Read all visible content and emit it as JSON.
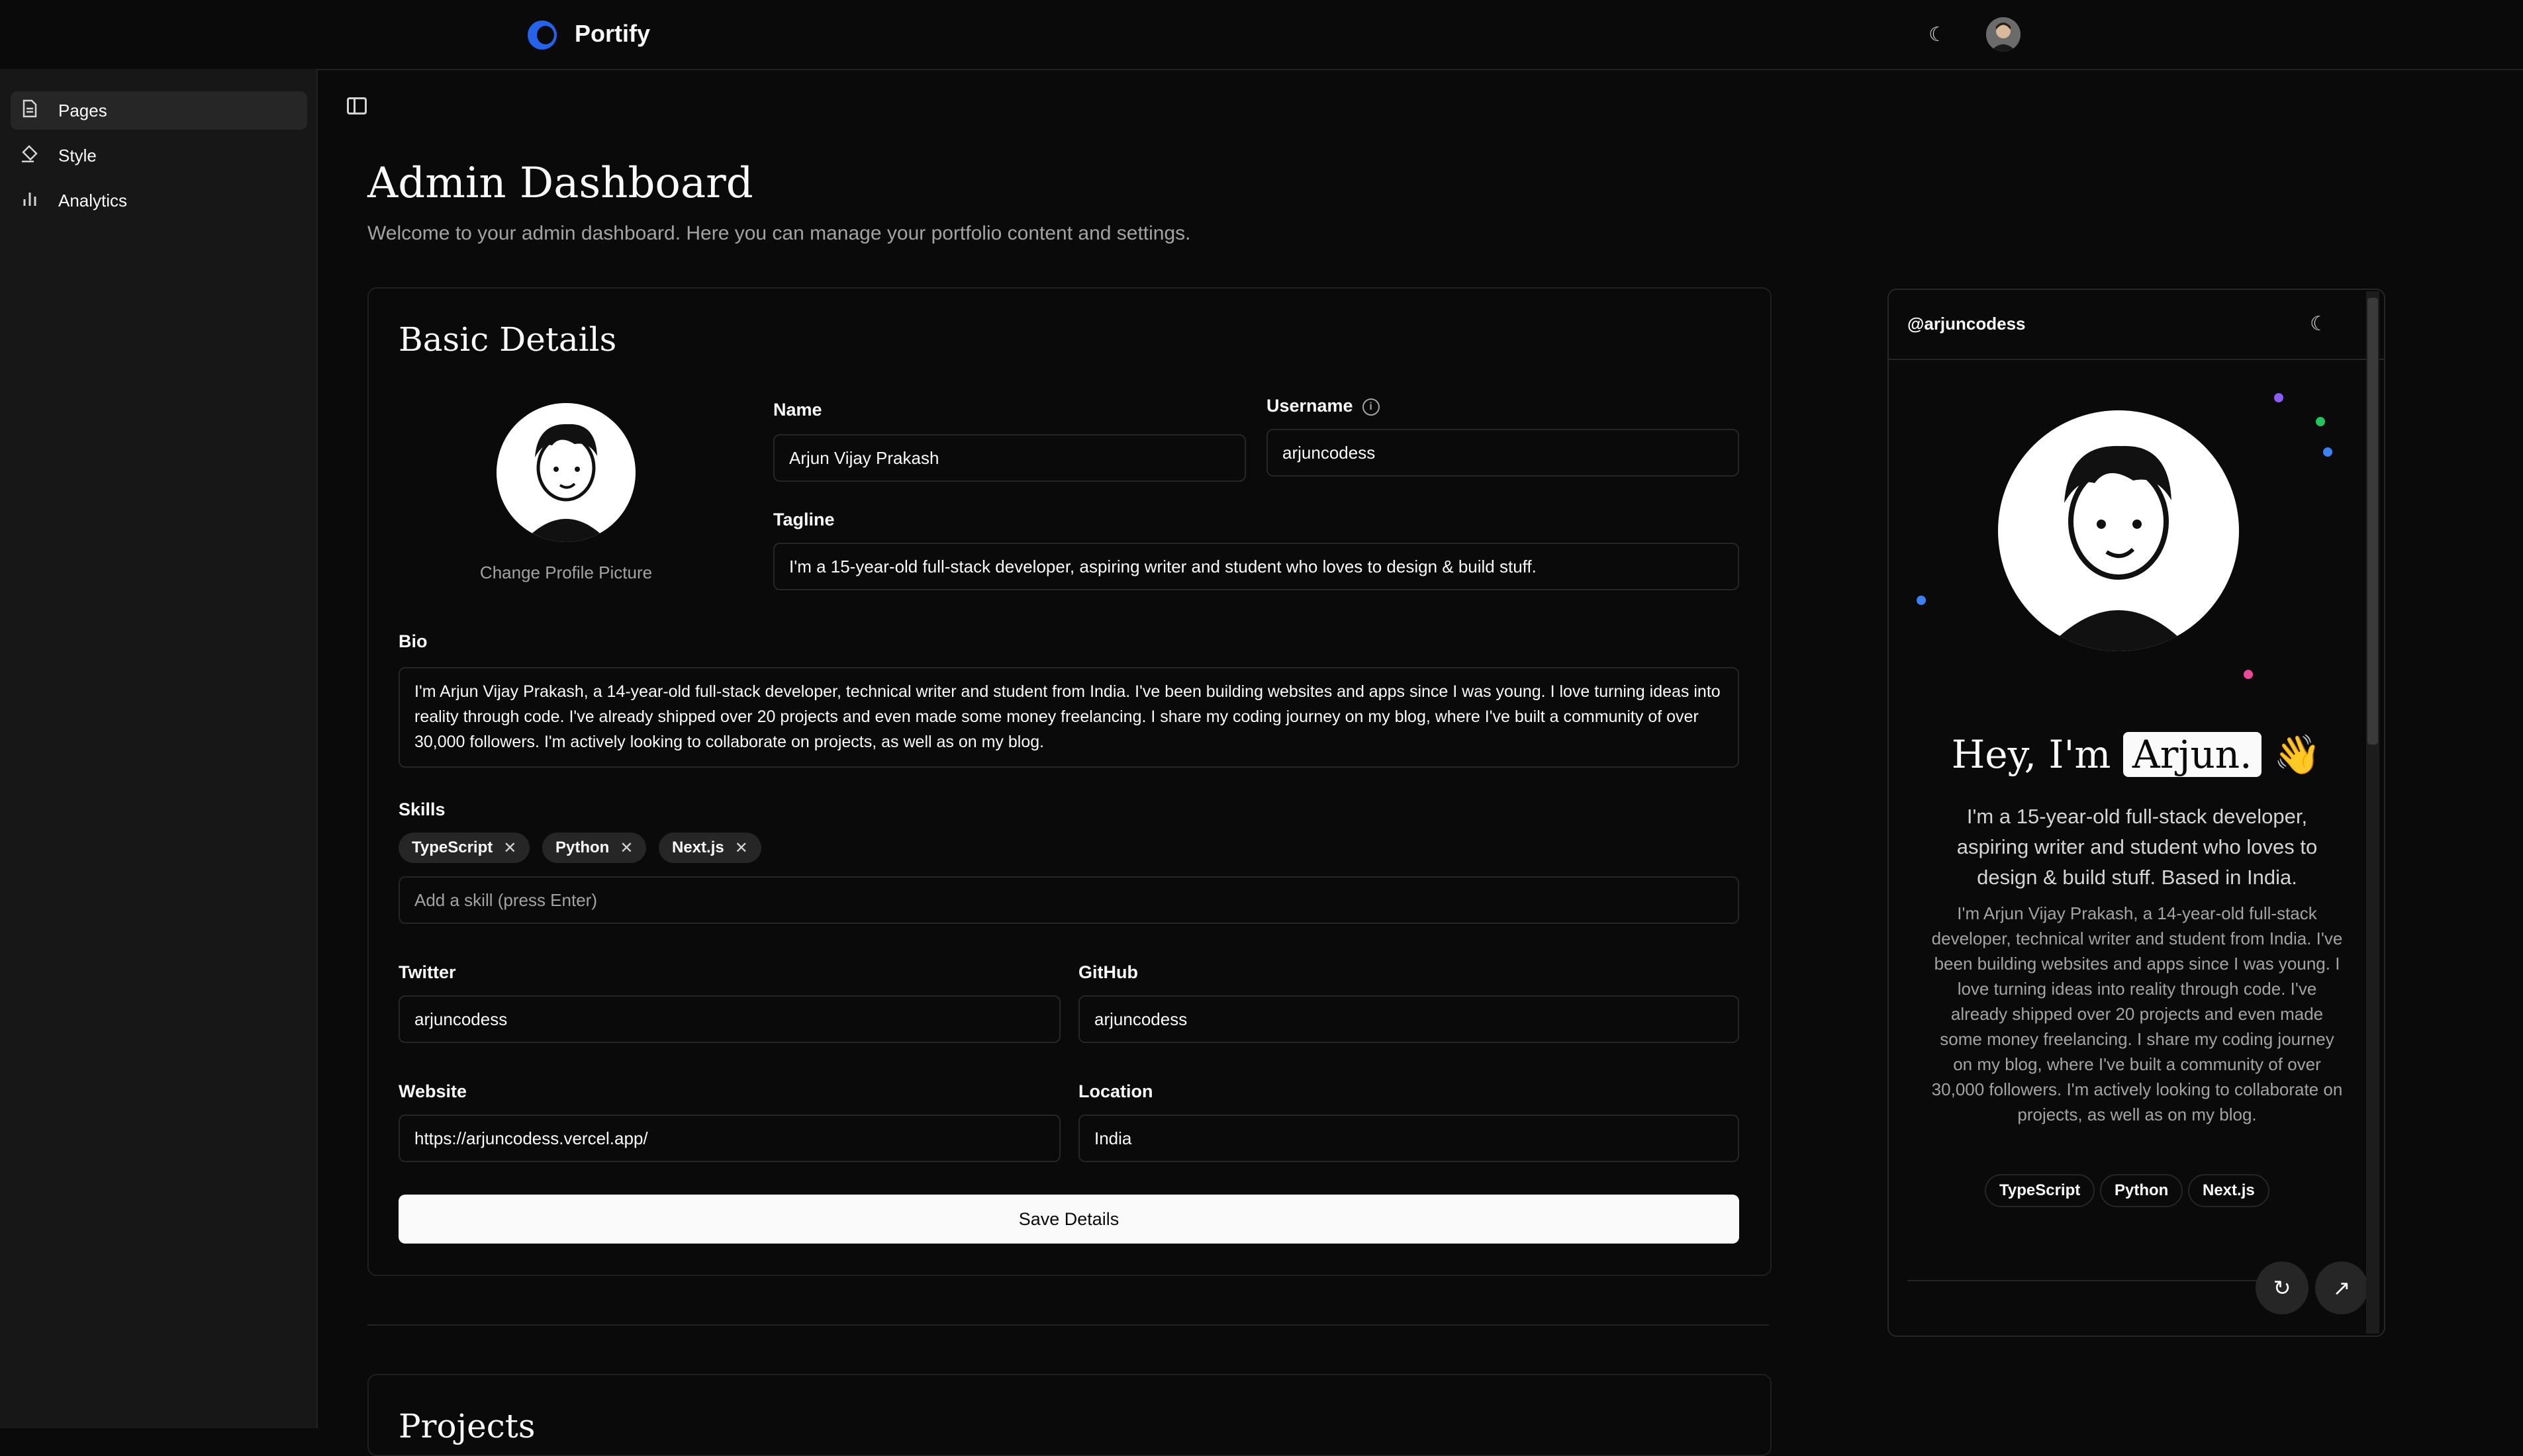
{
  "app": {
    "name": "Portify"
  },
  "sidebar": {
    "items": [
      {
        "label": "Pages",
        "icon": "file-icon",
        "active": true
      },
      {
        "label": "Style",
        "icon": "paint-bucket-icon",
        "active": false
      },
      {
        "label": "Analytics",
        "icon": "bar-chart-icon",
        "active": false
      }
    ]
  },
  "main": {
    "title": "Admin Dashboard",
    "subtitle": "Welcome to your admin dashboard. Here you can manage your portfolio content and settings."
  },
  "basic": {
    "title": "Basic Details",
    "change_picture": "Change Profile Picture",
    "name_label": "Name",
    "name_value": "Arjun Vijay Prakash",
    "username_label": "Username",
    "username_value": "arjuncodess",
    "tagline_label": "Tagline",
    "tagline_value": "I'm a 15-year-old full-stack developer, aspiring writer and student who loves to design & build stuff.",
    "bio_label": "Bio",
    "bio_value": "I'm Arjun Vijay Prakash, a 14-year-old full-stack developer, technical writer and student from India. I've been building websites and apps since I was young. I love turning ideas into reality through code. I've already shipped over 20 projects and even made some money freelancing. I share my coding journey on my blog, where I've built a community of over 30,000 followers. I'm actively looking to collaborate on projects, as well as on my blog.",
    "skills_label": "Skills",
    "skills": [
      "TypeScript",
      "Python",
      "Next.js"
    ],
    "skill_placeholder": "Add a skill (press Enter)",
    "twitter_label": "Twitter",
    "twitter_value": "arjuncodess",
    "github_label": "GitHub",
    "github_value": "arjuncodess",
    "website_label": "Website",
    "website_value": "https://arjuncodess.vercel.app/",
    "location_label": "Location",
    "location_value": "India",
    "save_label": "Save Details"
  },
  "projects": {
    "title": "Projects"
  },
  "preview": {
    "handle": "@arjuncodess",
    "hey_prefix": "Hey, I'm",
    "hey_name": "Arjun.",
    "wave": "👋",
    "tagline": "I'm a 15-year-old full-stack developer, aspiring writer and student who loves to design & build stuff. Based in India.",
    "bio": "I'm Arjun Vijay Prakash, a 14-year-old full-stack developer, technical writer and student from India. I've been building websites and apps since I was young. I love turning ideas into reality through code. I've already shipped over 20 projects and even made some money freelancing. I share my coding journey on my blog, where I've built a community of over 30,000 followers. I'm actively looking to collaborate on projects, as well as on my blog.",
    "skills": [
      "TypeScript",
      "Python",
      "Next.js"
    ]
  },
  "colors": {
    "accent": "#2563eb",
    "background": "#0a0a0a",
    "sidebar": "#171717"
  }
}
